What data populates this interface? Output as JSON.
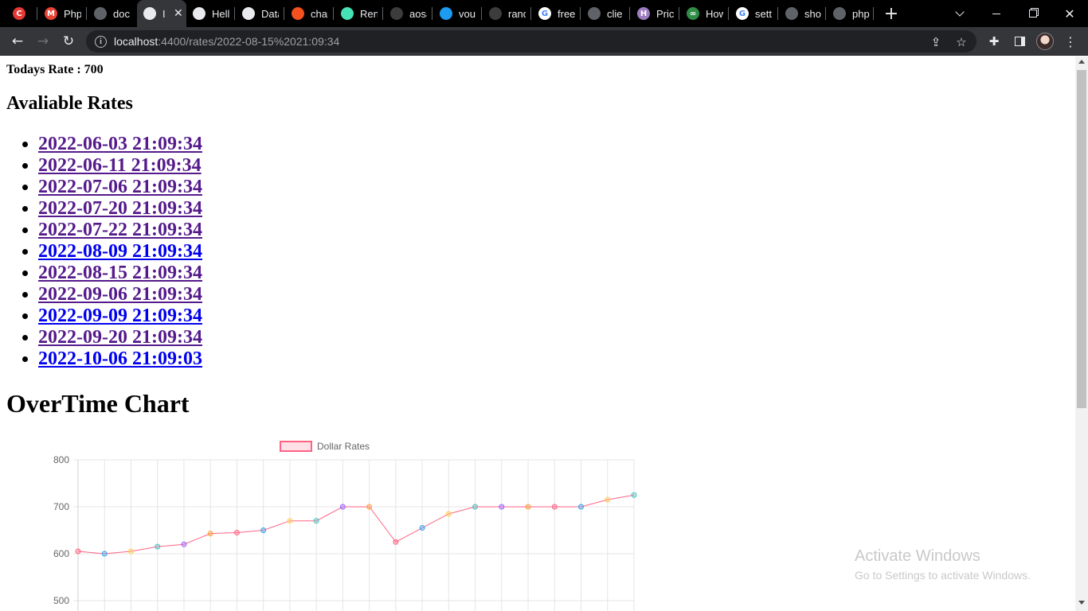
{
  "browser": {
    "tabs": [
      {
        "title": "",
        "favicon": "redis-icon",
        "color": "#e53935",
        "glyph": "C"
      },
      {
        "title": "Php",
        "favicon": "gmail-icon",
        "color": "#ea4335",
        "glyph": "M"
      },
      {
        "title": "doc",
        "favicon": "globe-icon",
        "color": "#5f6368",
        "glyph": ""
      },
      {
        "title": "I",
        "favicon": "globe-icon",
        "color": "#e8eaed",
        "glyph": "",
        "active": true
      },
      {
        "title": "Hell",
        "favicon": "globe-icon",
        "color": "#e8eaed",
        "glyph": ""
      },
      {
        "title": "Data",
        "favicon": "database-icon",
        "color": "#e8eaed",
        "glyph": ""
      },
      {
        "title": "char",
        "favicon": "shield-icon",
        "color": "#f4511e",
        "glyph": ""
      },
      {
        "title": "Ren",
        "favicon": "render-icon",
        "color": "#46e3b7",
        "glyph": ""
      },
      {
        "title": "aosa",
        "favicon": "github-icon",
        "color": "#3c3c3c",
        "glyph": ""
      },
      {
        "title": "vou",
        "favicon": "twitter-icon",
        "color": "#1d9bf0",
        "glyph": ""
      },
      {
        "title": "rand",
        "favicon": "github-icon",
        "color": "#3c3c3c",
        "glyph": ""
      },
      {
        "title": "free",
        "favicon": "google-icon",
        "color": "#ffffff",
        "glyph": "G"
      },
      {
        "title": "clie",
        "favicon": "globe-icon",
        "color": "#5f6368",
        "glyph": ""
      },
      {
        "title": "Pric",
        "favicon": "heroku-icon",
        "color": "#9e7cc1",
        "glyph": "H"
      },
      {
        "title": "How",
        "favicon": "geeksforgeeks-icon",
        "color": "#2f8d46",
        "glyph": "∞"
      },
      {
        "title": "sett",
        "favicon": "google-icon",
        "color": "#ffffff",
        "glyph": "G"
      },
      {
        "title": "sho",
        "favicon": "link-icon",
        "color": "#5f6368",
        "glyph": ""
      },
      {
        "title": "php",
        "favicon": "globe-icon",
        "color": "#5f6368",
        "glyph": ""
      }
    ],
    "new_tab_glyph": "+",
    "url_host": "localhost",
    "url_rest": ":4400/rates/2022-08-15%2021:09:34"
  },
  "page": {
    "today_rate": "Todays Rate : 700",
    "rates_heading": "Avaliable Rates",
    "rates": [
      {
        "label": "2022-06-03 21:09:34",
        "visited": true
      },
      {
        "label": "2022-06-11 21:09:34",
        "visited": true
      },
      {
        "label": "2022-07-06 21:09:34",
        "visited": true
      },
      {
        "label": "2022-07-20 21:09:34",
        "visited": true
      },
      {
        "label": "2022-07-22 21:09:34",
        "visited": true
      },
      {
        "label": "2022-08-09 21:09:34",
        "visited": false
      },
      {
        "label": "2022-08-15 21:09:34",
        "visited": true
      },
      {
        "label": "2022-09-06 21:09:34",
        "visited": true
      },
      {
        "label": "2022-09-09 21:09:34",
        "visited": false
      },
      {
        "label": "2022-09-20 21:09:34",
        "visited": true
      },
      {
        "label": "2022-10-06 21:09:03",
        "visited": false
      }
    ],
    "chart_heading": "OverTime Chart"
  },
  "chart_data": {
    "type": "line",
    "title": "",
    "xlabel": "",
    "ylabel": "",
    "ylim": [
      500,
      800
    ],
    "yticks": [
      800,
      700,
      600,
      500
    ],
    "grid": true,
    "legend_position": "top",
    "series": [
      {
        "name": "Dollar Rates",
        "line_color": "#ff6384",
        "values": [
          605,
          600,
          605,
          615,
          620,
          643,
          645,
          650,
          670,
          670,
          700,
          700,
          625,
          655,
          685,
          700,
          700,
          700,
          700,
          700,
          715,
          725
        ],
        "point_colors": [
          "#ff6384",
          "#36a2eb",
          "#ffce56",
          "#4bc0c0",
          "#9966ff",
          "#ff9f40",
          "#ff6384",
          "#36a2eb",
          "#ffce56",
          "#4bc0c0",
          "#9966ff",
          "#ff9f40",
          "#ff6384",
          "#36a2eb",
          "#ffce56",
          "#4bc0c0",
          "#9966ff",
          "#ff9f40",
          "#ff6384",
          "#36a2eb",
          "#ffce56",
          "#4bc0c0"
        ]
      }
    ]
  },
  "watermark": {
    "line1": "Activate Windows",
    "line2": "Go to Settings to activate Windows."
  }
}
